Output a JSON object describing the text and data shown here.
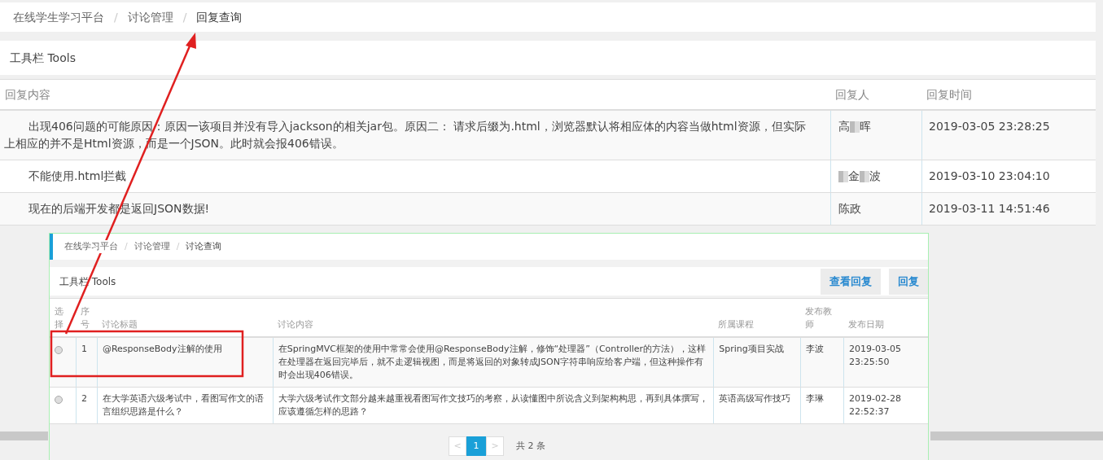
{
  "breadcrumb": [
    {
      "label": "在线学生学习平台",
      "current": false
    },
    {
      "label": "讨论管理",
      "current": false
    },
    {
      "label": "回复查询",
      "current": true
    }
  ],
  "breadcrumb_separator": "/",
  "toolbar": {
    "title": "工具栏 Tools"
  },
  "reply_table": {
    "columns": [
      "回复内容",
      "回复人",
      "回复时间"
    ],
    "rows": [
      {
        "content": "出现406问题的可能原因：原因一该项目并没有导入jackson的相关jar包。原因二： 请求后缀为.html，浏览器默认将相应体的内容当做html资源，但实际上相应的并不是Html资源，而是一个JSON。此时就会报406错误。",
        "replier": [
          {
            "kind": "text",
            "text": "高"
          },
          {
            "kind": "mosaic"
          },
          {
            "kind": "text",
            "text": "晖"
          }
        ],
        "time": "2019-03-05 23:28:25"
      },
      {
        "content": "不能使用.html拦截",
        "replier": [
          {
            "kind": "mosaic"
          },
          {
            "kind": "text",
            "text": "金"
          },
          {
            "kind": "mosaic"
          },
          {
            "kind": "text",
            "text": "波"
          }
        ],
        "time": "2019-03-10 23:04:10"
      },
      {
        "content": "现在的后端开发都是返回JSON数据!",
        "replier": [
          {
            "kind": "text",
            "text": "陈政"
          }
        ],
        "time": "2019-03-11 14:51:46"
      }
    ]
  },
  "inset": {
    "breadcrumb": [
      {
        "label": "在线学习平台",
        "current": false
      },
      {
        "label": "讨论管理",
        "current": false
      },
      {
        "label": "讨论查询",
        "current": true
      }
    ],
    "breadcrumb_separator": "/",
    "toolbar": {
      "title": "工具栏 Tools",
      "buttons": [
        "查看回复",
        "回复"
      ]
    },
    "columns": [
      "选择",
      "序号",
      "讨论标题",
      "讨论内容",
      "所属课程",
      "发布教师",
      "发布日期"
    ],
    "rows": [
      {
        "selected": false,
        "index": "1",
        "title": "@ResponseBody注解的使用",
        "content": "在SpringMVC框架的使用中常常会使用@ResponseBody注解，修饰“处理器”（Controller的方法），这样在处理器在返回完毕后，就不走逻辑视图，而是将返回的对象转成JSON字符串响应给客户端，但这种操作有时会出现406错误。",
        "course": "Spring项目实战",
        "teacher": "李波",
        "date": "2019-03-05 23:25:50"
      },
      {
        "selected": false,
        "index": "2",
        "title": "在大学英语六级考试中，看图写作文的语言组织思路是什么？",
        "content": "大学六级考试作文部分越来越重视看图写作文技巧的考察，从读懂图中所说含义到架构构思，再到具体撰写，应该遵循怎样的思路？",
        "course": "英语高级写作技巧",
        "teacher": "李琳",
        "date": "2019-02-28 22:52:37"
      }
    ],
    "pagination": {
      "prev": "<",
      "pages": [
        {
          "label": "1",
          "selected": true
        }
      ],
      "next": ">",
      "total": "共 2 条"
    }
  },
  "annotations": {
    "pointer_arrow": true,
    "highlight_box": true
  }
}
